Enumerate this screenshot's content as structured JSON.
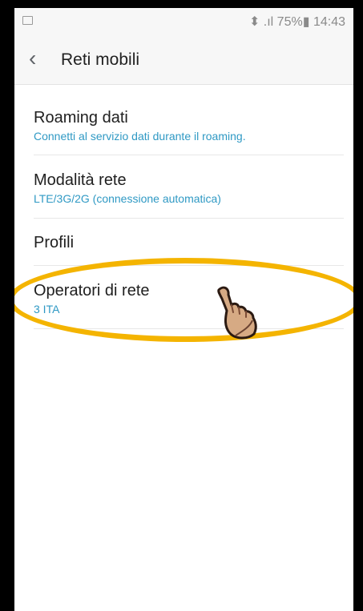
{
  "status": {
    "right_text": "⬍ .ıl 75%▮ 14:43"
  },
  "appbar": {
    "back_icon": "chevron-left-icon",
    "title": "Reti mobili"
  },
  "settings": [
    {
      "title": "Roaming dati",
      "subtitle": "Connetti al servizio dati durante il roaming."
    },
    {
      "title": "Modalità rete",
      "subtitle": "LTE/3G/2G (connessione automatica)"
    },
    {
      "title": "Profili",
      "subtitle": ""
    },
    {
      "title": "Operatori di rete",
      "subtitle": "3 ITA"
    }
  ],
  "annotation": {
    "highlight_color": "#f4b400",
    "pointer_icon": "hand-pointer-icon"
  }
}
